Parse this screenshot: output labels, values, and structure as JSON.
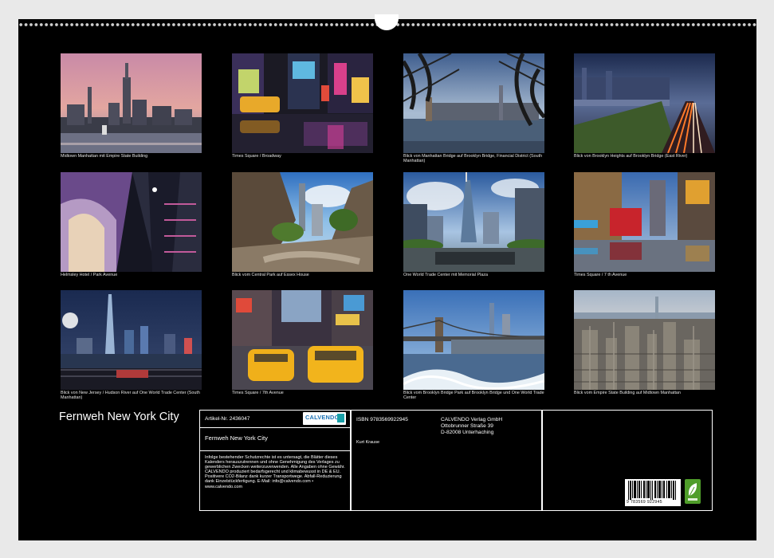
{
  "photos": [
    {
      "caption": "Midtown Manhattan mit Empire State Building"
    },
    {
      "caption": "Times Square / Broadway"
    },
    {
      "caption": "Blick von Manhattan Bridge auf Brooklyn Bridge, Financial District (South Manhattan)"
    },
    {
      "caption": "Blick von Brooklyn Heights auf Brooklyn Bridge (East River)"
    },
    {
      "caption": "Helmsley  Hotel / Park Avenue"
    },
    {
      "caption": "Blick vom Central Park auf Essex House"
    },
    {
      "caption": "One World Trade Center mit Memorial Plaza"
    },
    {
      "caption": "Times Square / 7 th Avenue"
    },
    {
      "caption": "Blick von New Jersey / Hudson River auf One World Trade Center (South Manhattan)"
    },
    {
      "caption": "Times Square / 7th Avenue"
    },
    {
      "caption": "Blick vom Brooklyn Bridge Park auf Brooklyn Bridge und One World Trade Center"
    },
    {
      "caption": "Blick vom Empire State Building auf Midtown Manhattan"
    }
  ],
  "calendar": {
    "title": "Fernweh New York City"
  },
  "info": {
    "article_label": "Artikel-Nr. 2436047",
    "calendar_name": "Fernweh New York City",
    "logo_text": "CALVENDO",
    "isbn": "ISBN 9783569922945",
    "publisher_name": "CALVENDO Verlag GmbH",
    "publisher_street": "Ottobrunner Straße 39",
    "publisher_city": "D-82008 Unterhaching",
    "author": "Kurt Krause",
    "legal_text": "Infolge bestehender Schutzrechte ist es untersagt, die Blätter dieses Kalenders herauszutrennen und ohne Genehmigung des Verlages zu gewerblichen Zwecken weiterzuverwenden. Alle Angaben ohne Gewähr. CALVENDO produziert bedarfsgerecht und klimabewusst in DE & EU. Positivere CO2-Bilanz dank kurzer Transportwege. Abfall-Reduzierung dank Einzelstückfertigung. E-Mail: info@calvendo.com • www.calvendo.com",
    "barcode_digits": "9 783569 922945"
  },
  "colors": {
    "page_bg": "#000000",
    "binding": "#cfcfcf",
    "eco_green": "#4f9d2a",
    "brand_blue": "#1b72b5"
  }
}
